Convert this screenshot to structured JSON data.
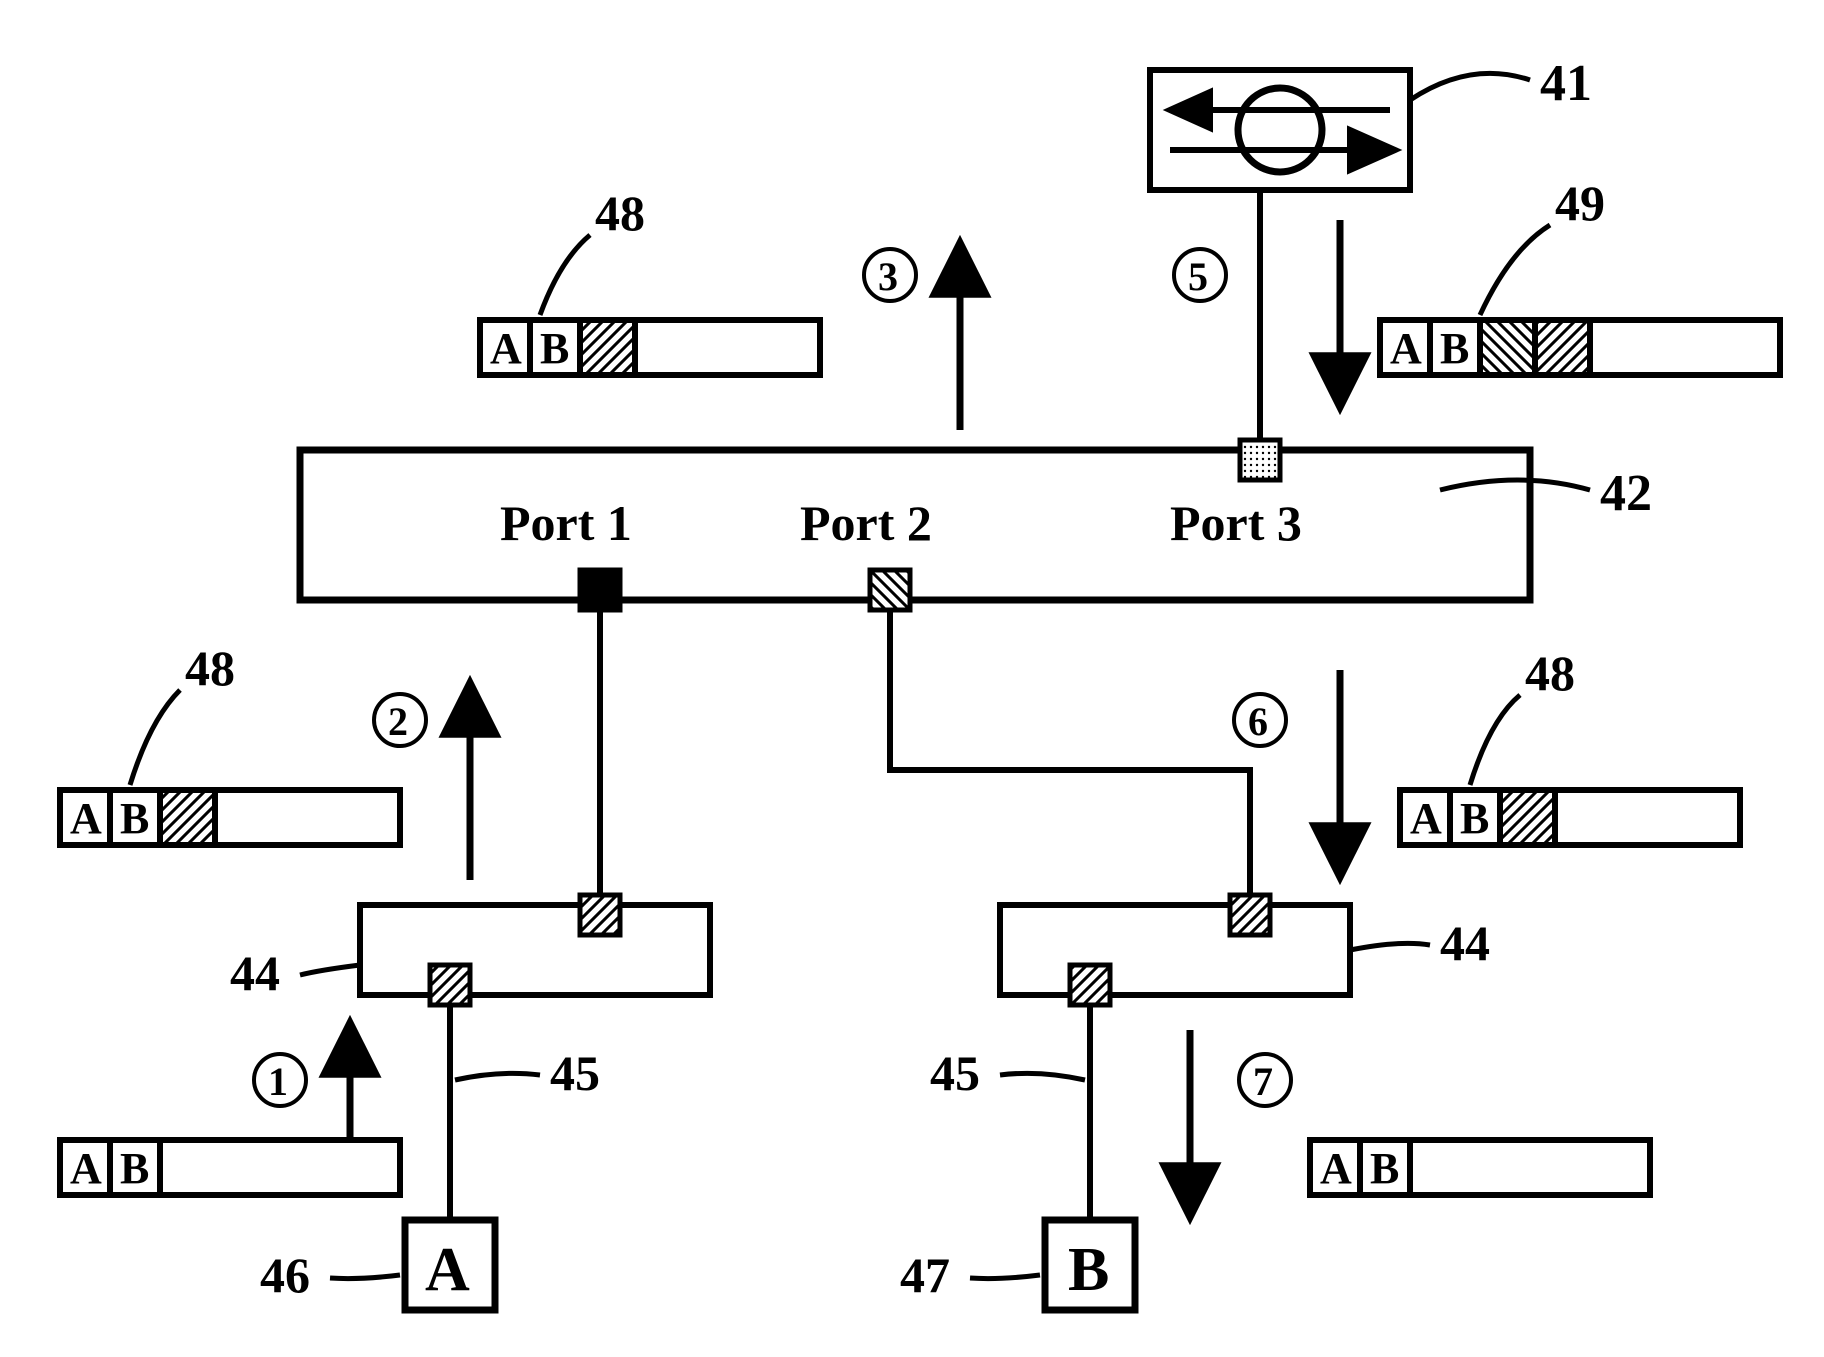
{
  "refs": {
    "router": "41",
    "switch": "42",
    "hub_left": "44",
    "hub_right": "44",
    "link_left": "45",
    "link_right": "45",
    "host_a": "46",
    "host_b": "47",
    "packet_48_a": "48",
    "packet_48_b": "48",
    "packet_48_c": "48",
    "packet_49": "49"
  },
  "ports": {
    "p1": "Port 1",
    "p2": "Port 2",
    "p3": "Port 3"
  },
  "hosts": {
    "a": "A",
    "b": "B"
  },
  "steps": {
    "s1": "1",
    "s2": "2",
    "s3": "3",
    "s5": "5",
    "s6": "6",
    "s7": "7"
  },
  "packet_cells": {
    "a": "A",
    "b": "B"
  },
  "chart_data": {
    "type": "diagram",
    "nodes": [
      {
        "id": 41,
        "role": "router"
      },
      {
        "id": 42,
        "role": "switch",
        "ports": [
          "Port 1",
          "Port 2",
          "Port 3"
        ]
      },
      {
        "id": 44,
        "role": "hub",
        "count": 2
      },
      {
        "id": 46,
        "role": "host",
        "label": "A"
      },
      {
        "id": 47,
        "role": "host",
        "label": "B"
      }
    ],
    "links": [
      {
        "id": 45,
        "from": 46,
        "to": 44
      },
      {
        "id": 45,
        "from": 47,
        "to": 44
      },
      {
        "from": 44,
        "to": 42,
        "port": "Port 1"
      },
      {
        "from": 44,
        "to": 42,
        "port": "Port 2"
      },
      {
        "from": 42,
        "port": "Port 3",
        "to": 41
      }
    ],
    "packets": [
      {
        "step": 1,
        "ref": 46,
        "fields": [
          "A",
          "B"
        ],
        "tags": 0
      },
      {
        "step": 2,
        "ref": 48,
        "fields": [
          "A",
          "B"
        ],
        "tags": 1
      },
      {
        "step": 3,
        "ref": 48,
        "fields": [
          "A",
          "B"
        ],
        "tags": 1
      },
      {
        "step": 5,
        "ref": 49,
        "fields": [
          "A",
          "B"
        ],
        "tags": 2
      },
      {
        "step": 6,
        "ref": 48,
        "fields": [
          "A",
          "B"
        ],
        "tags": 1
      },
      {
        "step": 7,
        "ref": 47,
        "fields": [
          "A",
          "B"
        ],
        "tags": 0
      }
    ],
    "flow_sequence": [
      1,
      2,
      3,
      5,
      6,
      7
    ]
  }
}
